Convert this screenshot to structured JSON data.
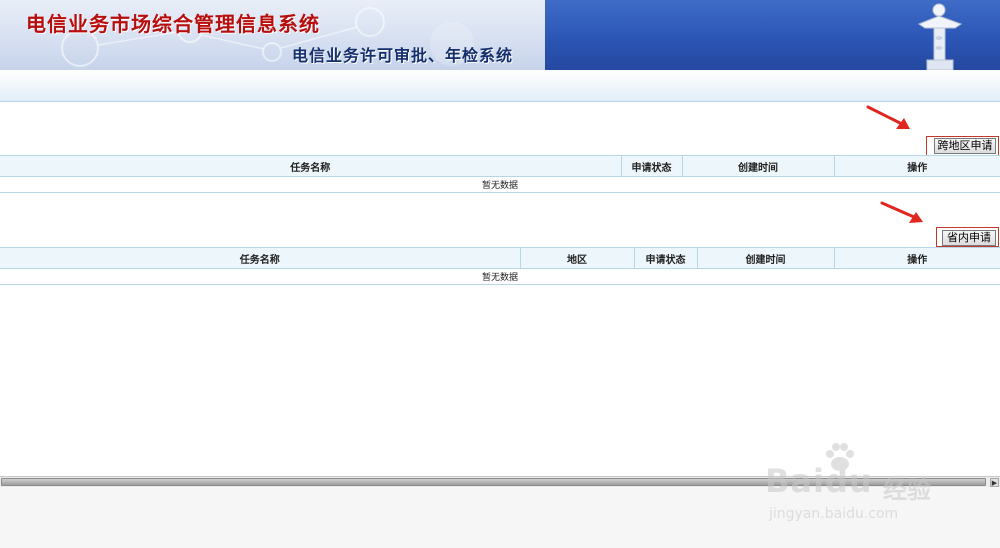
{
  "header": {
    "system_title": "电信业务市场综合管理信息系统",
    "subsystem_title": "电信业务许可审批、年检系统"
  },
  "section1": {
    "action_label": "跨地区申请",
    "columns": [
      "任务名称",
      "申请状态",
      "创建时间",
      "操作"
    ],
    "empty_text": "暂无数据"
  },
  "section2": {
    "action_label": "省内申请",
    "columns": [
      "任务名称",
      "地区",
      "申请状态",
      "创建时间",
      "操作"
    ],
    "empty_text": "暂无数据"
  },
  "watermark": {
    "brand": "Baidu",
    "brand_cn": "经验",
    "url": "jingyan.baidu.com"
  },
  "colors": {
    "banner_title": "#b80d0d",
    "banner_sub": "#142f6e",
    "table_header_bg": "#ecf6fb",
    "table_border": "#b7d6e6",
    "annotation_arrow": "#e0261f"
  },
  "icons": {
    "monument": "huabiao-column-icon",
    "arrow": "red-arrow-icon",
    "scroll_right": "scroll-right-arrow-icon"
  }
}
